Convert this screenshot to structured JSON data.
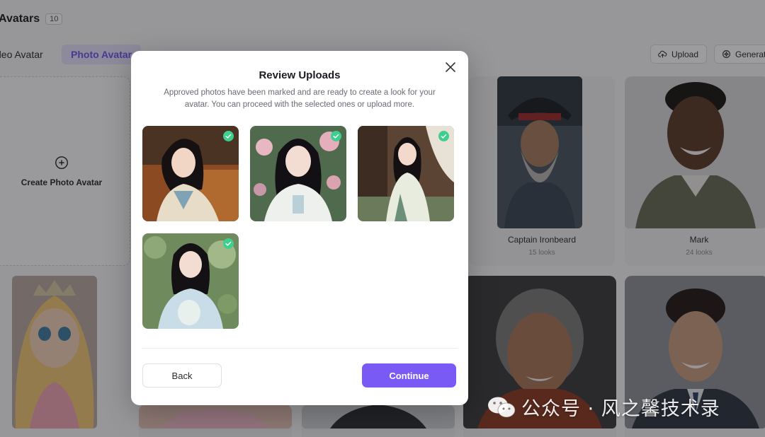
{
  "header": {
    "title": "Avatars",
    "count": "10"
  },
  "tabs": [
    {
      "label": "Video Avatar",
      "visible_text": "deo Avatar"
    },
    {
      "label": "Photo Avatar",
      "visible_text": "Photo Avatar"
    }
  ],
  "toolbar": {
    "upload_label": "Upload",
    "generate_label": "Generat"
  },
  "create_card": {
    "label": "Create Photo Avatar"
  },
  "avatars": [
    {
      "name": "Captain Ironbeard",
      "looks": "15 looks"
    },
    {
      "name": "Mark",
      "looks": "24 looks"
    }
  ],
  "modal": {
    "title": "Review Uploads",
    "description": "Approved photos have been marked and are ready to create a look for your avatar. You can proceed with the selected ones or upload more.",
    "photo_count": 4,
    "back_label": "Back",
    "continue_label": "Continue"
  },
  "watermark": {
    "text": "公众号 · 风之馨技术录"
  },
  "colors": {
    "accent": "#7a5af5",
    "check": "#3ecf8e",
    "tab_active_bg": "#e6e1fb"
  },
  "icons": {
    "close": "close-icon",
    "check": "check-circle-icon",
    "upload": "cloud-upload-icon",
    "generate": "sparkle-icon",
    "add": "plus-circle-icon"
  }
}
